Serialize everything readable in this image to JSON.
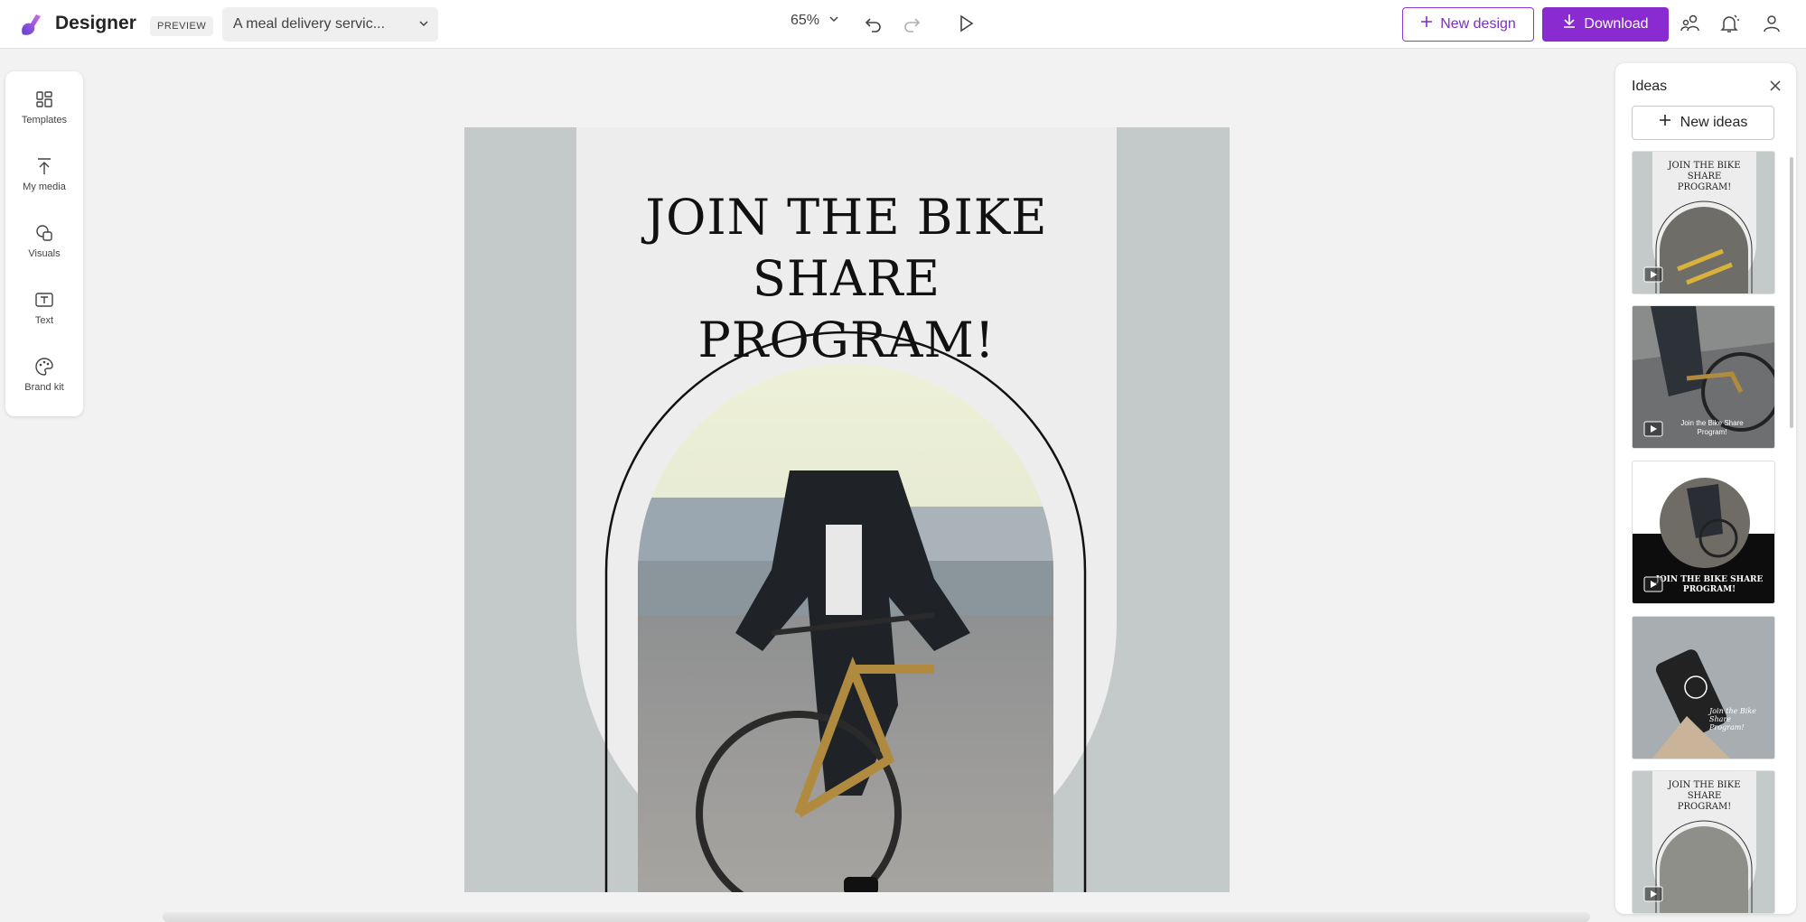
{
  "app": {
    "title": "Designer",
    "badge": "PREVIEW",
    "document_title": "A meal delivery servic..."
  },
  "toolbar": {
    "zoom": "65%",
    "new_design_label": "New design",
    "download_label": "Download"
  },
  "sidebar": {
    "items": [
      {
        "label": "Templates",
        "icon": "templates-icon"
      },
      {
        "label": "My media",
        "icon": "upload-icon"
      },
      {
        "label": "Visuals",
        "icon": "visuals-icon"
      },
      {
        "label": "Text",
        "icon": "text-icon"
      },
      {
        "label": "Brand kit",
        "icon": "palette-icon"
      }
    ]
  },
  "canvas": {
    "headline_lines": [
      "JOIN THE BIKE",
      "SHARE",
      "PROGRAM!"
    ]
  },
  "ideas": {
    "title": "Ideas",
    "new_ideas_label": "New ideas",
    "thumbnails": [
      {
        "title_lines": [
          "JOIN THE BIKE",
          "SHARE",
          "PROGRAM!"
        ],
        "style": "arch-light"
      },
      {
        "title_lines": [
          "Join the Bike Share",
          "Program!"
        ],
        "style": "photo-full"
      },
      {
        "title_lines": [
          "JOIN THE BIKE SHARE",
          "PROGRAM!"
        ],
        "style": "dark-circle"
      },
      {
        "title_lines": [
          "Join the Bike",
          "Share",
          "Program!"
        ],
        "style": "phone-photo"
      },
      {
        "title_lines": [
          "JOIN THE BIKE",
          "SHARE",
          "PROGRAM!"
        ],
        "style": "arch-light"
      }
    ]
  },
  "colors": {
    "accent": "#8a2bd1",
    "canvas_bg": "#c4c9c9",
    "panel_bg": "#ededed"
  }
}
